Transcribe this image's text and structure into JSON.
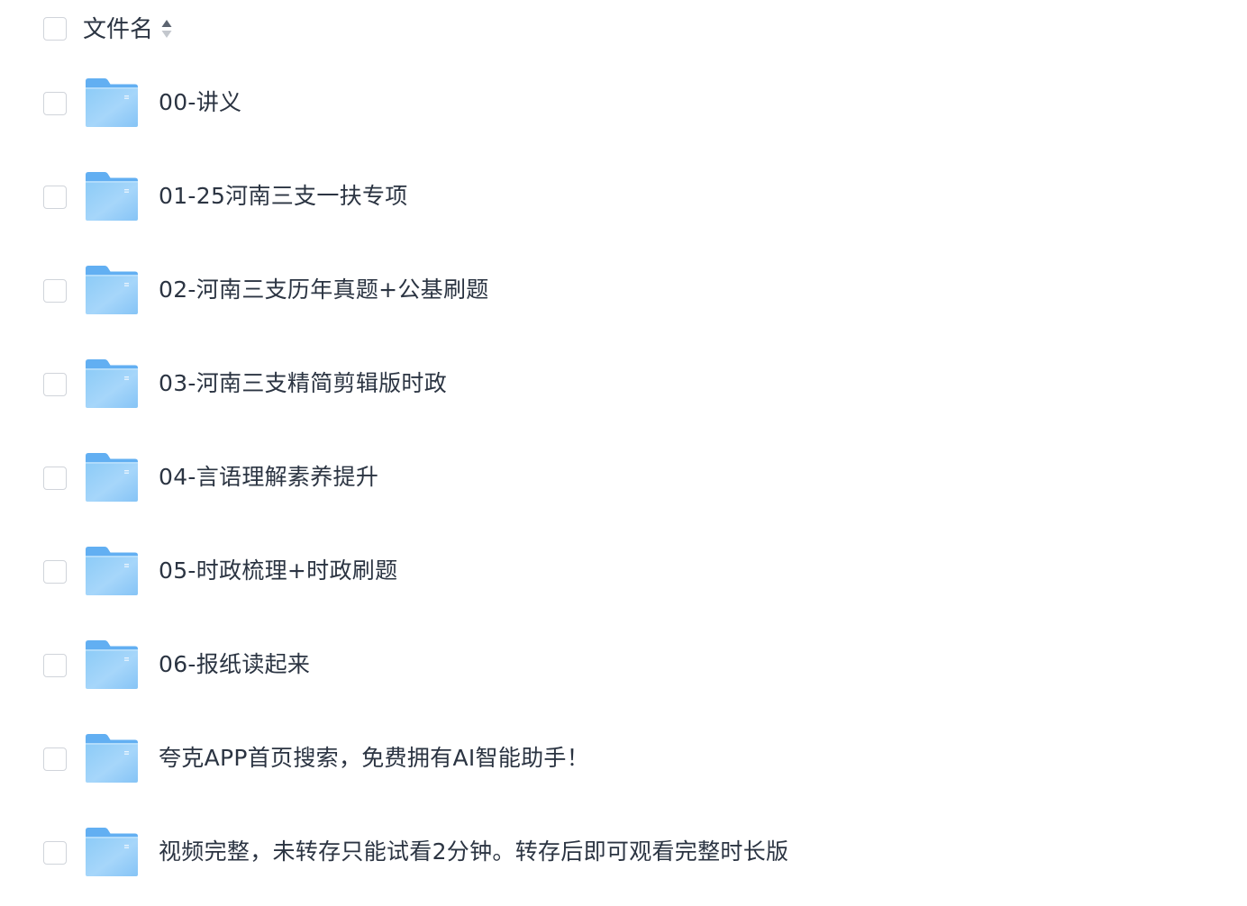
{
  "header": {
    "column_label": "文件名",
    "sort_icon": "sort-up-down-icon"
  },
  "files": [
    {
      "name": "00-讲义",
      "type": "folder"
    },
    {
      "name": "01-25河南三支一扶专项",
      "type": "folder"
    },
    {
      "name": "02-河南三支历年真题+公基刷题",
      "type": "folder"
    },
    {
      "name": "03-河南三支精简剪辑版时政",
      "type": "folder"
    },
    {
      "name": "04-言语理解素养提升",
      "type": "folder"
    },
    {
      "name": "05-时政梳理+时政刷题",
      "type": "folder"
    },
    {
      "name": "06-报纸读起来",
      "type": "folder"
    },
    {
      "name": "夸克APP首页搜索，免费拥有AI智能助手！",
      "type": "folder"
    },
    {
      "name": "视频完整，未转存只能试看2分钟。转存后即可观看完整时长版",
      "type": "folder"
    }
  ],
  "colors": {
    "folder_front": "#7cc0f4",
    "folder_back": "#5aaaf0",
    "text": "#2b3442",
    "checkbox_border": "#d0d4da"
  }
}
